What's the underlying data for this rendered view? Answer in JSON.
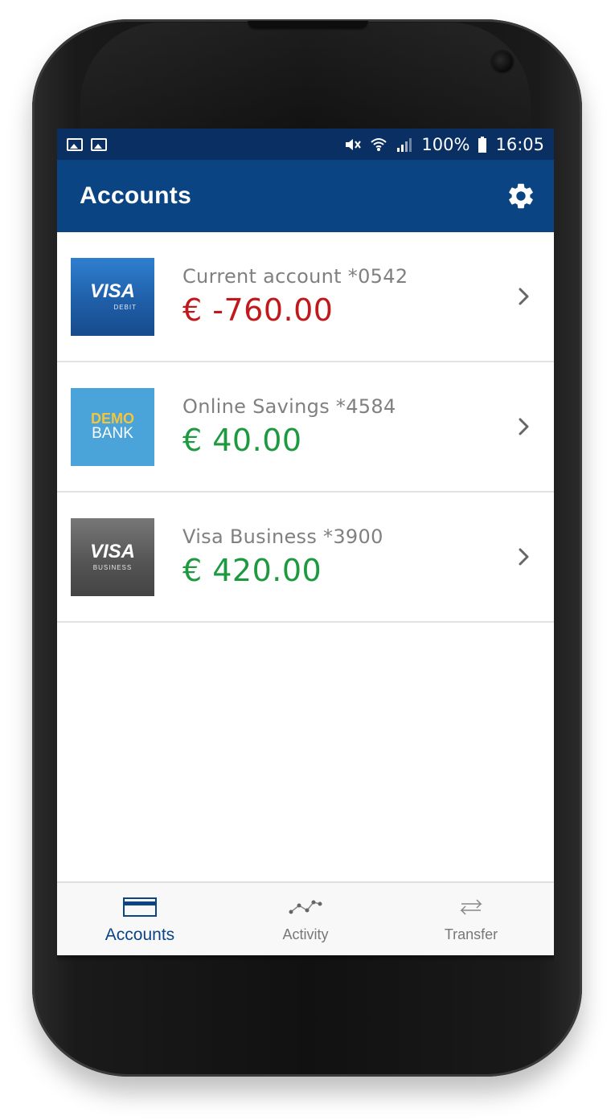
{
  "status_bar": {
    "battery": "100%",
    "time": "16:05",
    "icons": [
      "image-icon",
      "image-icon",
      "mute-icon",
      "wifi-icon",
      "signal-icon",
      "battery-icon"
    ]
  },
  "app_bar": {
    "title": "Accounts",
    "settings_icon": "gear-icon"
  },
  "accounts": [
    {
      "name": "Current account *0542",
      "balance": "€ -760.00",
      "status": "negative",
      "card": {
        "type": "visa-debit",
        "brand": "VISA",
        "sub": "DEBIT"
      }
    },
    {
      "name": "Online Savings *4584",
      "balance": "€ 40.00",
      "status": "positive",
      "card": {
        "type": "demo-bank",
        "brand": "DEMO",
        "sub": "BANK"
      }
    },
    {
      "name": "Visa Business *3900",
      "balance": "€ 420.00",
      "status": "positive",
      "card": {
        "type": "visa-business",
        "brand": "VISA",
        "sub": "BUSINESS"
      }
    }
  ],
  "bottom_nav": {
    "items": [
      {
        "label": "Accounts",
        "icon": "card-icon",
        "active": true
      },
      {
        "label": "Activity",
        "icon": "activity-icon",
        "active": false
      },
      {
        "label": "Transfer",
        "icon": "transfer-icon",
        "active": false
      }
    ]
  },
  "colors": {
    "status_bar": "#0a2f63",
    "app_bar": "#0b4483",
    "negative": "#c0181b",
    "positive": "#1d9a40",
    "active_nav": "#0b4483"
  }
}
